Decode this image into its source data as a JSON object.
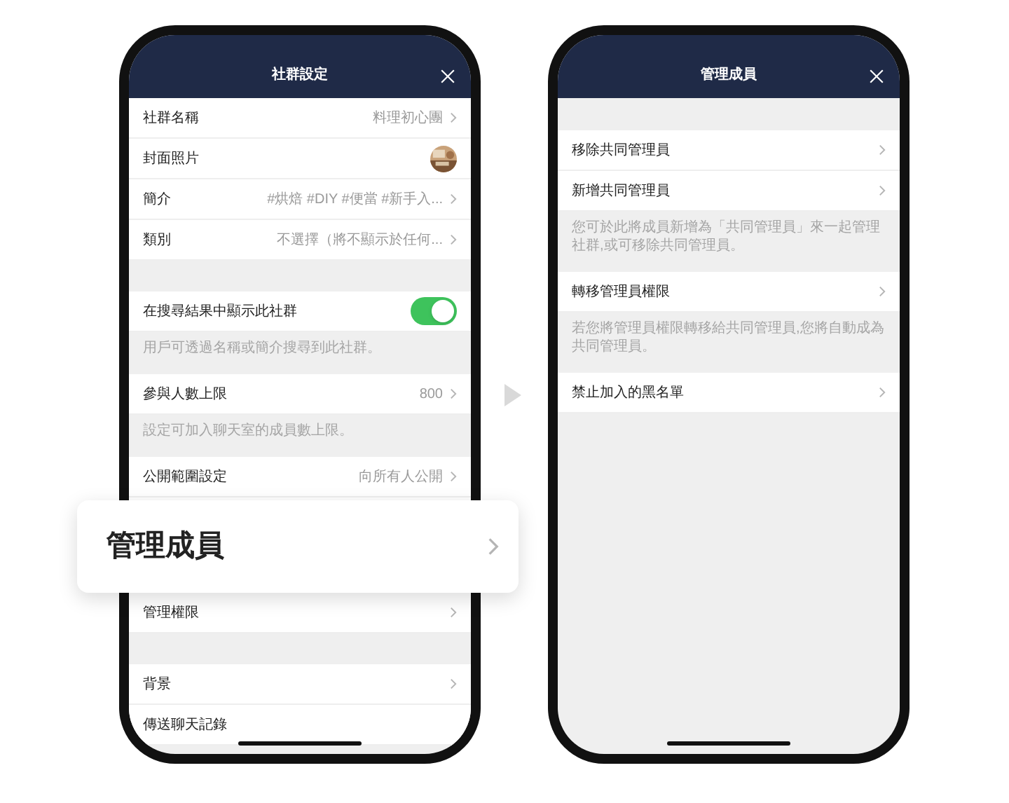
{
  "phones": [
    {
      "title": "社群設定",
      "sections": [
        {
          "items": [
            {
              "kind": "link",
              "label": "社群名稱",
              "value": "料理初心團"
            },
            {
              "label": "封面照片"
            },
            {
              "kind": "link",
              "label": "簡介",
              "value": "#烘焙 #DIY #便當 #新手入..."
            },
            {
              "kind": "link",
              "label": "類別",
              "value": "不選擇（將不顯示於任何..."
            }
          ]
        },
        {
          "items": [
            {
              "kind": "toggle",
              "label": "在搜尋結果中顯示此社群",
              "on": true
            }
          ],
          "note": "用戶可透過名稱或簡介搜尋到此社群。"
        },
        {
          "items": [
            {
              "kind": "link",
              "label": "參與人數上限",
              "value": "800"
            }
          ],
          "note": "設定可加入聊天室的成員數上限。"
        },
        {
          "items": [
            {
              "kind": "link",
              "label": "公開範圍設定",
              "value": "向所有人公開"
            },
            {
              "kind": "covered"
            },
            {
              "kind": "link",
              "label": "管理權限"
            }
          ]
        },
        {
          "items": [
            {
              "kind": "link",
              "label": "背景"
            },
            {
              "kind": "plain",
              "label": "傳送聊天記錄"
            }
          ]
        }
      ]
    },
    {
      "title": "管理成員",
      "sections": [
        {
          "items": [
            {
              "kind": "link",
              "label": "移除共同管理員"
            },
            {
              "kind": "link",
              "label": "新增共同管理員"
            }
          ],
          "note": "您可於此將成員新增為「共同管理員」來一起管理社群,或可移除共同管理員。"
        },
        {
          "items": [
            {
              "kind": "link",
              "label": "轉移管理員權限"
            }
          ],
          "note": "若您將管理員權限轉移給共同管理員,您將自動成為共同管理員。"
        },
        {
          "items": [
            {
              "kind": "link",
              "label": "禁止加入的黑名單"
            }
          ]
        }
      ]
    }
  ],
  "highlight": {
    "label": "管理成員"
  }
}
